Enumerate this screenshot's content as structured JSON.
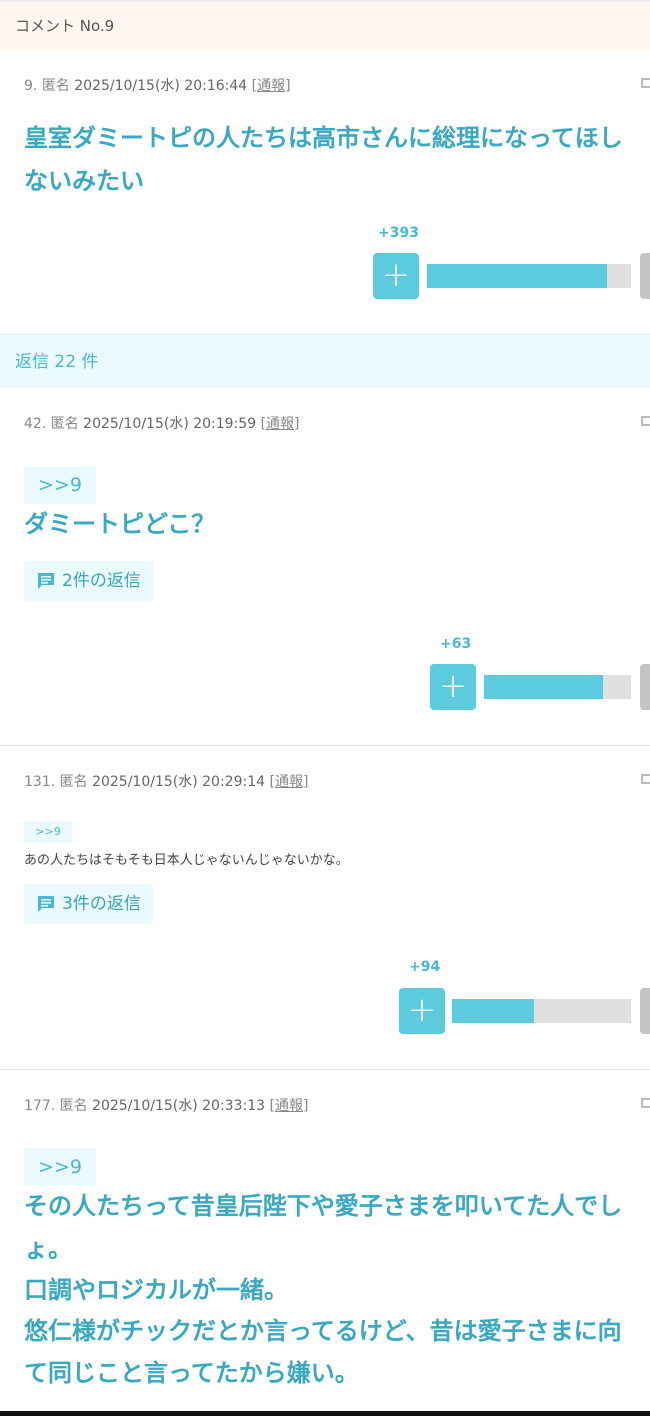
{
  "header": {
    "title": "コメント No.9"
  },
  "parent": {
    "number": "9.",
    "author": "匿名",
    "date": "2025/10/15(水) 20:16:44",
    "report": "[通報]",
    "lines": [
      "皇室ダミートピの人たちは高市さんに総理になってほし",
      "ないみたい"
    ],
    "votes": "+393",
    "plus_label": "+",
    "vote_ratio": 0.88
  },
  "replies_banner": {
    "text": "返信 22 件"
  },
  "comments": [
    {
      "number": "42.",
      "author": "匿名",
      "date": "2025/10/15(水) 20:19:59",
      "report": "[通報]",
      "anchor": ">>9",
      "lines": [
        "ダミートピどこ？"
      ],
      "reply_label": "2件の返信",
      "votes": "+63",
      "plus_label": "+",
      "vote_ratio": 0.81
    },
    {
      "number": "131.",
      "author": "匿名",
      "date": "2025/10/15(水) 20:29:14",
      "report": "[通報]",
      "anchor": ">>9",
      "lines": [
        "あの人たちはそもそも日本人じゃないんじゃないかな。"
      ],
      "reply_label": "3件の返信",
      "votes": "+94",
      "plus_label": "+",
      "vote_ratio": 0.46
    },
    {
      "number": "177.",
      "author": "匿名",
      "date": "2025/10/15(水) 20:33:13",
      "report": "[通報]",
      "anchor": ">>9",
      "lines": [
        "その人たちって昔皇后陛下や愛子さまを叩いてた人でし",
        "ょ。",
        "口調やロジカルが一緒。",
        "悠仁様がチックだとか言ってるけど、昔は愛子さまに向",
        "て同じこと言ってたから嫌い。"
      ]
    }
  ],
  "colors": {
    "accent": "#5ccbde",
    "text_accent": "#39a9c2",
    "banner_bg": "#eafaff",
    "header_bg": "#fff7f0"
  }
}
